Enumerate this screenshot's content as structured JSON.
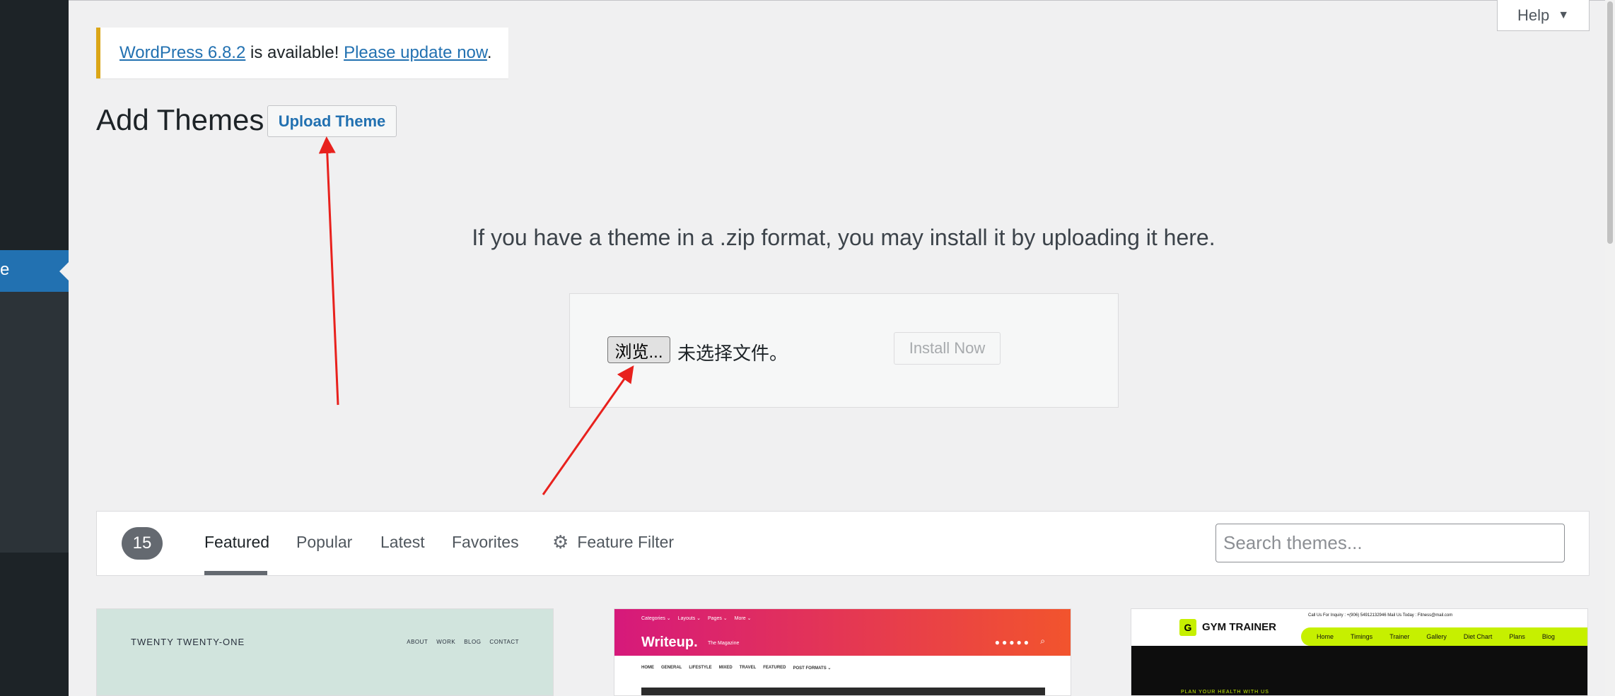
{
  "sidebar": {
    "active_item_label": "e"
  },
  "help": {
    "label": "Help"
  },
  "notice": {
    "version_link": "WordPress 6.8.2",
    "middle_text": " is available! ",
    "update_link": "Please update now",
    "end_text": "."
  },
  "header": {
    "title": "Add Themes",
    "upload_button": "Upload Theme"
  },
  "upload": {
    "help_text": "If you have a theme in a .zip format, you may install it by uploading it here.",
    "browse_button": "浏览...",
    "file_status": "未选择文件。",
    "install_button": "Install Now"
  },
  "filter": {
    "count": "15",
    "tabs": [
      {
        "label": "Featured",
        "current": true
      },
      {
        "label": "Popular",
        "current": false
      },
      {
        "label": "Latest",
        "current": false
      },
      {
        "label": "Favorites",
        "current": false
      }
    ],
    "feature_filter": "Feature Filter",
    "search_placeholder": "Search themes..."
  },
  "themes": {
    "twenty": {
      "site_title": "TWENTY TWENTY-ONE",
      "nav": [
        "ABOUT",
        "WORK",
        "BLOG",
        "CONTACT"
      ]
    },
    "writeup": {
      "topnav": [
        "Categories ⌄",
        "Layouts ⌄",
        "Pages ⌄",
        "More ⌄"
      ],
      "brand": "Writeup.",
      "tagline": "The Magazine",
      "subnav": [
        "HOME",
        "GENERAL",
        "LIFESTYLE",
        "MIXED",
        "TRAVEL",
        "FEATURED",
        "POST FORMATS ⌄"
      ]
    },
    "gym": {
      "logo_letter": "G",
      "logo_text": "GYM TRAINER",
      "contact": "Call Us For Inquiry : +(906) 54912132946    Mail Us Today : Fitness@mail.com",
      "menu": [
        "Home",
        "Timings",
        "Trainer",
        "Gallery",
        "Diet Chart",
        "Plans",
        "Blog"
      ],
      "slogan": "PLAN YOUR HEALTH WITH US"
    }
  },
  "colors": {
    "accent": "#2271b1",
    "notice_border": "#dba617",
    "annotation_arrow": "#e8211d"
  },
  "icons": [
    "gear-icon",
    "chevron-down-icon",
    "magnifier-icon"
  ]
}
